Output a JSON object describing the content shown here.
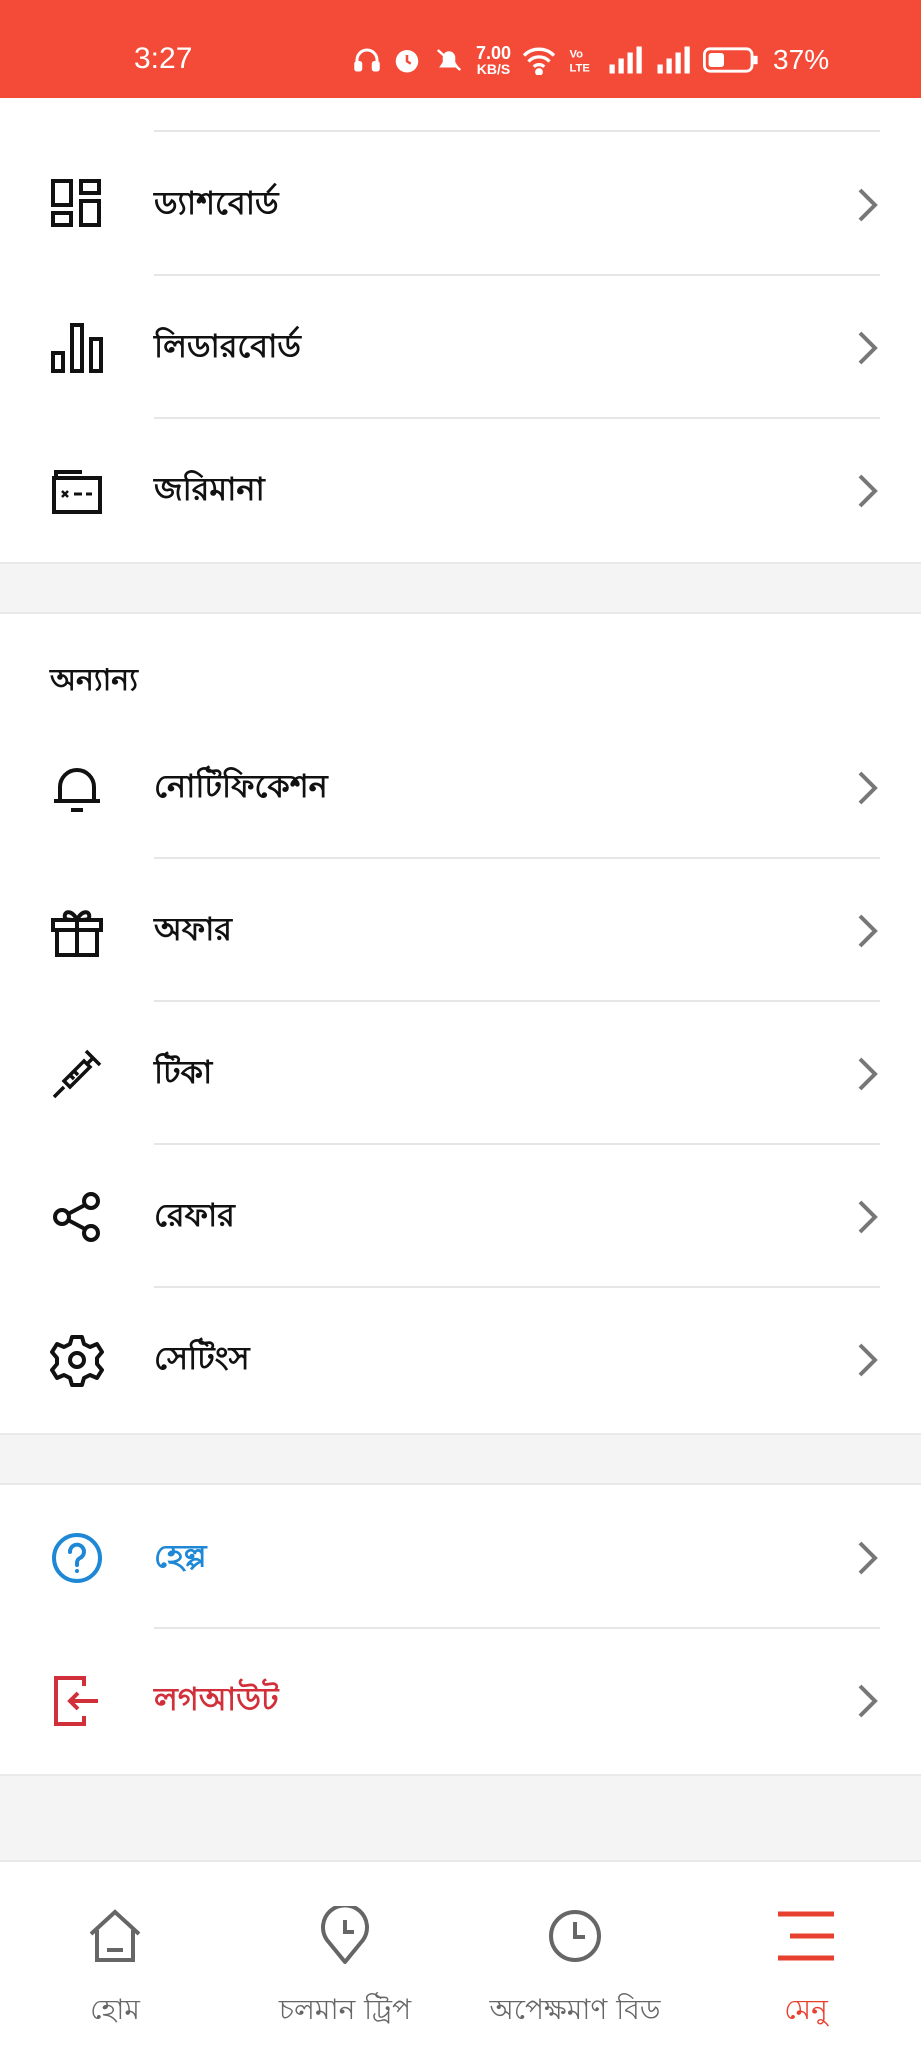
{
  "status_bar": {
    "time": "3:27",
    "net_speed_value": "7.00",
    "net_speed_unit": "KB/S",
    "battery_percent": "37%",
    "background_color": "#f34b38"
  },
  "menu_group_1": [
    {
      "label": "ড্যাশবোর্ড",
      "icon": "dashboard-icon"
    },
    {
      "label": "লিডারবোর্ড",
      "icon": "bar-chart-icon"
    },
    {
      "label": "জরিমানা",
      "icon": "fine-wallet-icon"
    }
  ],
  "others_section": {
    "title": "অন্যান্য",
    "items": [
      {
        "label": "নোটিফিকেশন",
        "icon": "bell-icon"
      },
      {
        "label": "অফার",
        "icon": "gift-icon"
      },
      {
        "label": "টিকা",
        "icon": "syringe-icon"
      },
      {
        "label": "রেফার",
        "icon": "share-icon"
      },
      {
        "label": "সেটিংস",
        "icon": "gear-icon"
      }
    ]
  },
  "menu_group_3": [
    {
      "label": "হেল্প",
      "icon": "help-icon",
      "color": "#1e88d6"
    },
    {
      "label": "লগআউট",
      "icon": "logout-icon",
      "color": "#d12f3a"
    }
  ],
  "bottom_nav": {
    "items": [
      {
        "label": "হোম",
        "icon": "home-icon"
      },
      {
        "label": "চলমান ট্রিপ",
        "icon": "location-clock-icon"
      },
      {
        "label": "অপেক্ষমাণ বিড",
        "icon": "clock-icon"
      },
      {
        "label": "মেনু",
        "icon": "menu-icon",
        "active": true
      }
    ],
    "active_color": "#e8402f"
  }
}
